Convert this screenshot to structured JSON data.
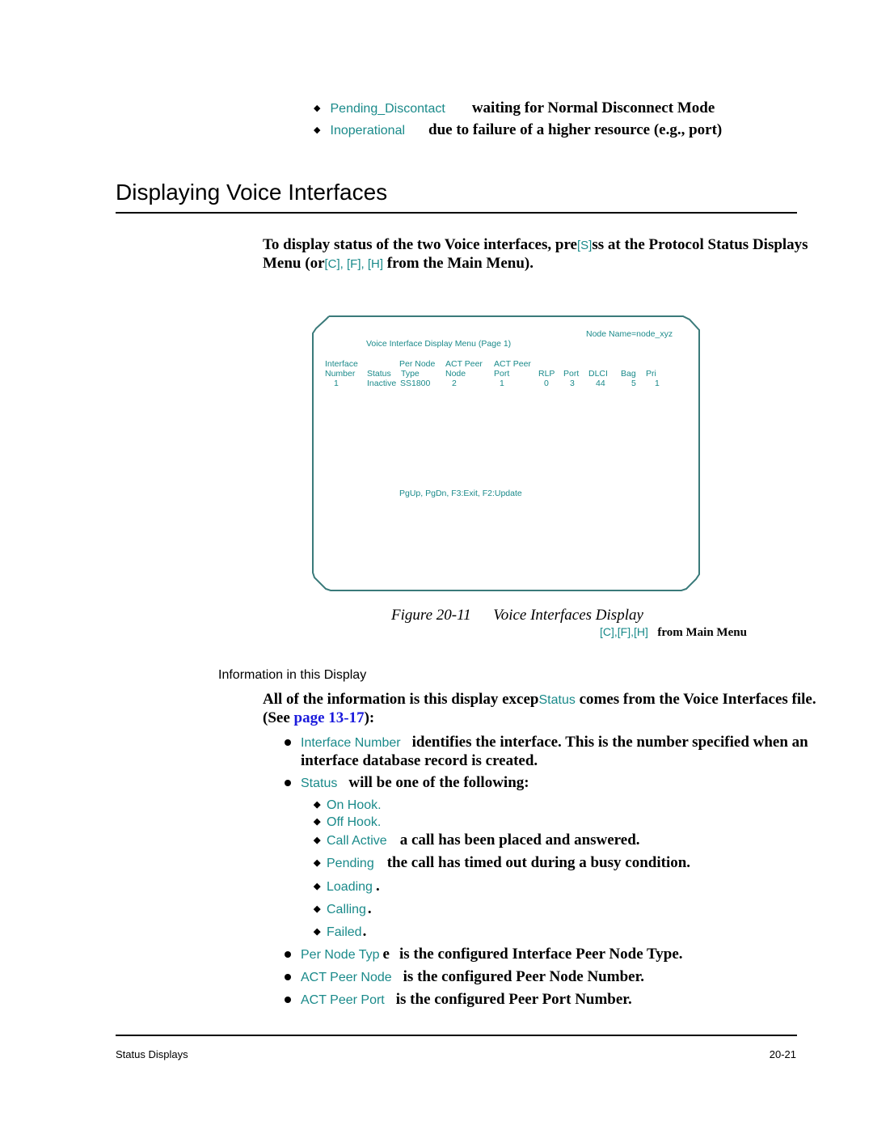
{
  "top_states": [
    {
      "term": "Pending_Discontact",
      "desc": "waiting for Normal Disconnect Mode"
    },
    {
      "term": "Inoperational",
      "desc": "due to failure of a higher resource (e.g., port)"
    }
  ],
  "section": {
    "title": "Displaying Voice Interfaces"
  },
  "intro": {
    "text_1": "To display status of the two Voice interfaces, pre",
    "key": "[S]",
    "text_2": "ss at the Protocol Status Displays Menu (or",
    "keys_main": "[C], [F], [H]",
    "text_3": " from the Main Menu)."
  },
  "terminal": {
    "node_name": "Node Name=node_xyz",
    "menu_title": "Voice Interface Display Menu (Page 1)",
    "columns": [
      {
        "line1": "Interface",
        "line2": "Number"
      },
      {
        "line1": "",
        "line2": "Status"
      },
      {
        "line1": "Per Node",
        "line2": "Type"
      },
      {
        "line1": "ACT Peer",
        "line2": "Node"
      },
      {
        "line1": "ACT Peer",
        "line2": "Port"
      },
      {
        "line1": "",
        "line2": "RLP"
      },
      {
        "line1": "",
        "line2": "Port"
      },
      {
        "line1": "",
        "line2": "DLCI"
      },
      {
        "line1": "",
        "line2": "Bag"
      },
      {
        "line1": "",
        "line2": "Pri"
      }
    ],
    "rows": [
      [
        "1",
        "Inactive",
        "SS1800",
        "2",
        "1",
        "0",
        "3",
        "44",
        "5",
        "1"
      ]
    ],
    "help_line": "PgUp, PgDn, F3:Exit, F2:Update"
  },
  "figure": {
    "caption_number": "Figure 20-11",
    "caption_title": "Voice Interfaces Display",
    "path_keys": "[C],[F],[H]",
    "path_text": "from Main Menu"
  },
  "info": {
    "heading": "Information in this Display",
    "para_1": "All of the information is this display excep",
    "para_term": "Status",
    "para_2": " comes from the Voice Interfaces file. (See ",
    "para_link": "page 13-17",
    "para_3": "):"
  },
  "bullets": [
    {
      "term": "Interface Number",
      "desc": "identifies the interface. This is the number specified when an interface database record is created."
    },
    {
      "term": "Status",
      "desc": "will be one of the following:"
    }
  ],
  "status_values": [
    {
      "term": "On Hook.",
      "desc": ""
    },
    {
      "term": "Off Hook.",
      "desc": ""
    },
    {
      "term": "Call Active",
      "desc": "a call has been placed and answered."
    },
    {
      "term": "Pending",
      "desc": "the call has timed out during a busy condition."
    },
    {
      "term": "Loading",
      "desc": "."
    },
    {
      "term": "Calling",
      "desc": "."
    },
    {
      "term": "Failed",
      "desc": "."
    }
  ],
  "more_bullets": [
    {
      "term": "Per Node Typ",
      "term_tail": "e",
      "desc": "is the configured Interface Peer Node Type."
    },
    {
      "term": "ACT Peer Node",
      "term_tail": "",
      "desc": "is the configured Peer Node Number."
    },
    {
      "term": "ACT Peer Port",
      "term_tail": "",
      "desc": "is the configured Peer Port Number."
    }
  ],
  "footer": {
    "left": "Status Displays",
    "right": "20-21"
  },
  "colors": {
    "accent_teal": "#1a8a8a",
    "link_blue": "#1a1adc",
    "terminal_border": "#3a7a7a"
  }
}
